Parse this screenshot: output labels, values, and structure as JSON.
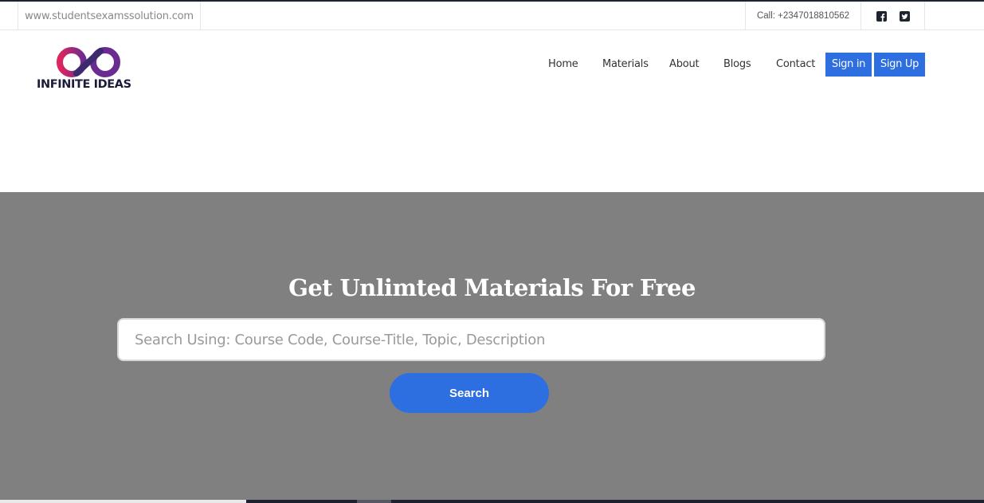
{
  "topbar": {
    "site_url": "www.studentsexamssolution.com",
    "phone": "Call: +2347018810562",
    "social_icons": [
      "facebook-square-icon",
      "twitter-square-icon"
    ]
  },
  "logo": {
    "text": "INFINITE IDEAS"
  },
  "nav": {
    "home": "Home",
    "materials": "Materials",
    "about": "About",
    "blogs": "Blogs",
    "contact": "Contact",
    "sign_in": "Sign in",
    "sign_up": "Sign Up"
  },
  "hero": {
    "title": "Get Unlimted Materials For Free",
    "search_placeholder": "Search Using: Course Code, Course-Title, Topic, Description",
    "search_value": "",
    "search_button": "Search"
  },
  "colors": {
    "accent": "#2d6fe0",
    "hero_background": "#808080",
    "logo_gradient": [
      "#e0245e",
      "#6b2c91"
    ]
  }
}
